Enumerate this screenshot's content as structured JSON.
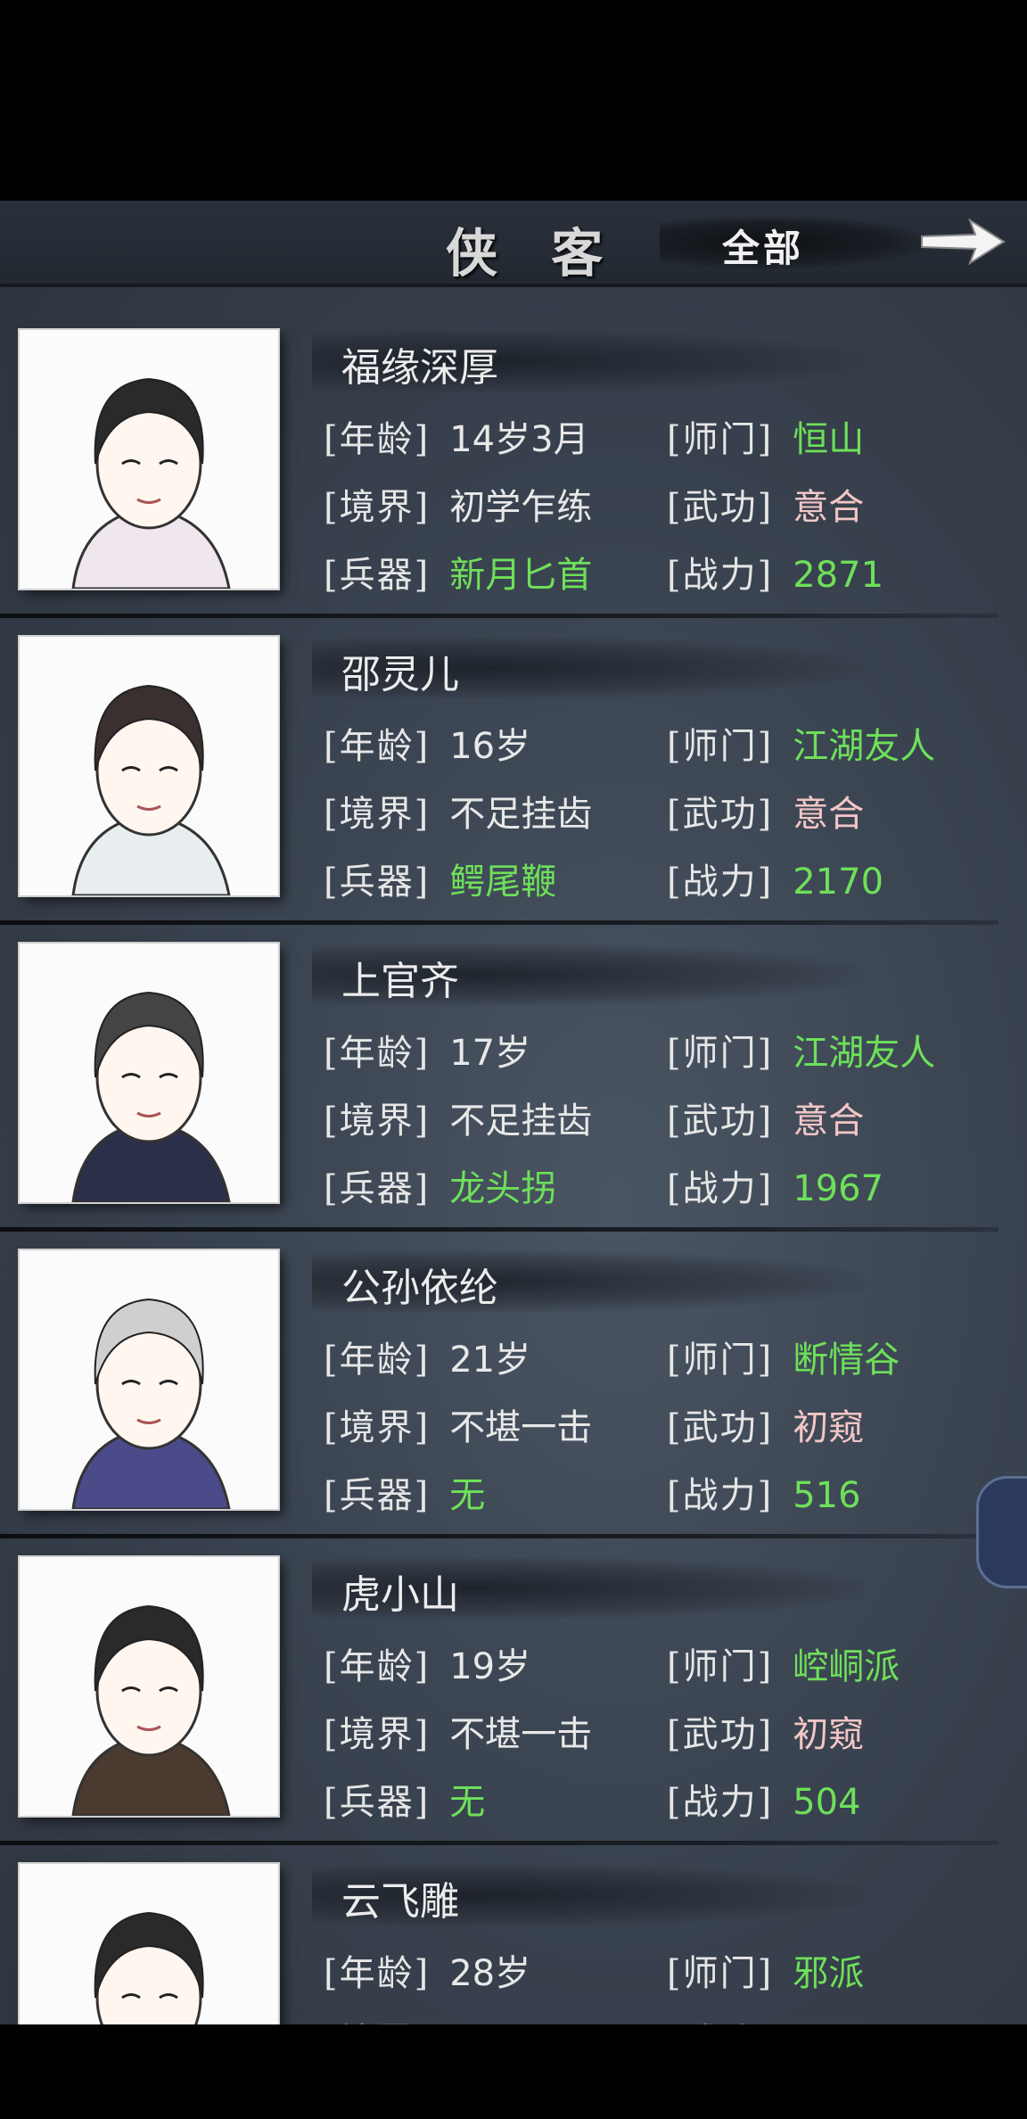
{
  "header": {
    "title": "侠 客",
    "filter_label": "全部",
    "next_icon": "arrow-right-icon"
  },
  "labels": {
    "age": "[年龄]",
    "school": "[师门]",
    "realm": "[境界]",
    "martial": "[武功]",
    "weapon": "[兵器]",
    "power": "[战力]"
  },
  "colors": {
    "green": "#6ee05a",
    "pink": "#f2c6c6",
    "white": "#e8e8e8"
  },
  "characters": [
    {
      "name": "福缘深厚",
      "age": "14岁3月",
      "school": "恒山",
      "realm": "初学乍练",
      "martial": "意合",
      "weapon": "新月匕首",
      "power": "2871"
    },
    {
      "name": "邵灵儿",
      "age": "16岁",
      "school": "江湖友人",
      "realm": "不足挂齿",
      "martial": "意合",
      "weapon": "鳄尾鞭",
      "power": "2170"
    },
    {
      "name": "上官齐",
      "age": "17岁",
      "school": "江湖友人",
      "realm": "不足挂齿",
      "martial": "意合",
      "weapon": "龙头拐",
      "power": "1967"
    },
    {
      "name": "公孙依纶",
      "age": "21岁",
      "school": "断情谷",
      "realm": "不堪一击",
      "martial": "初窥",
      "weapon": "无",
      "power": "516"
    },
    {
      "name": "虎小山",
      "age": "19岁",
      "school": "崆峒派",
      "realm": "不堪一击",
      "martial": "初窥",
      "weapon": "无",
      "power": "504"
    },
    {
      "name": "云飞雕",
      "age": "28岁",
      "school": "邪派",
      "realm": "",
      "martial": "",
      "weapon": "",
      "power": ""
    }
  ]
}
